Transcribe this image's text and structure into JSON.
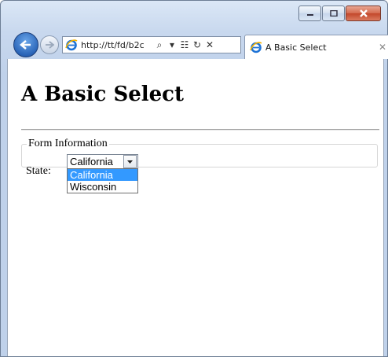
{
  "browser": {
    "address_url": "http://tt/fd/b2c",
    "tab_title": "A Basic Select"
  },
  "page": {
    "heading": "A Basic Select",
    "legend": "Form Information",
    "state_label": "State:",
    "select": {
      "selected": "California",
      "options": [
        "California",
        "Wisconsin"
      ]
    }
  },
  "colors": {
    "highlight": "#3399ff",
    "back_button": "#2a65b8"
  }
}
